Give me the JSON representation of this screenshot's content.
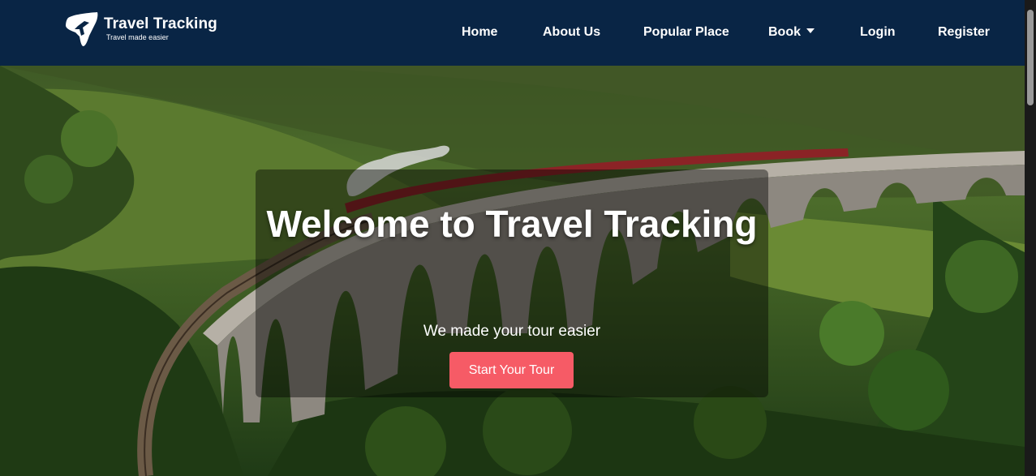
{
  "brand": {
    "title": "Travel Tracking",
    "tagline": "Travel made easier",
    "icon": "paper-plane-icon"
  },
  "nav": {
    "home": "Home",
    "about": "About Us",
    "popular": "Popular Place",
    "book": "Book",
    "login": "Login",
    "register": "Register"
  },
  "hero": {
    "title": "Welcome to Travel Tracking",
    "subtitle": "We made your tour easier",
    "cta": "Start Your Tour",
    "image": "train-on-viaduct-landscape"
  },
  "colors": {
    "navbar": "#092545",
    "cta": "#f65b66",
    "text": "#ffffff"
  }
}
